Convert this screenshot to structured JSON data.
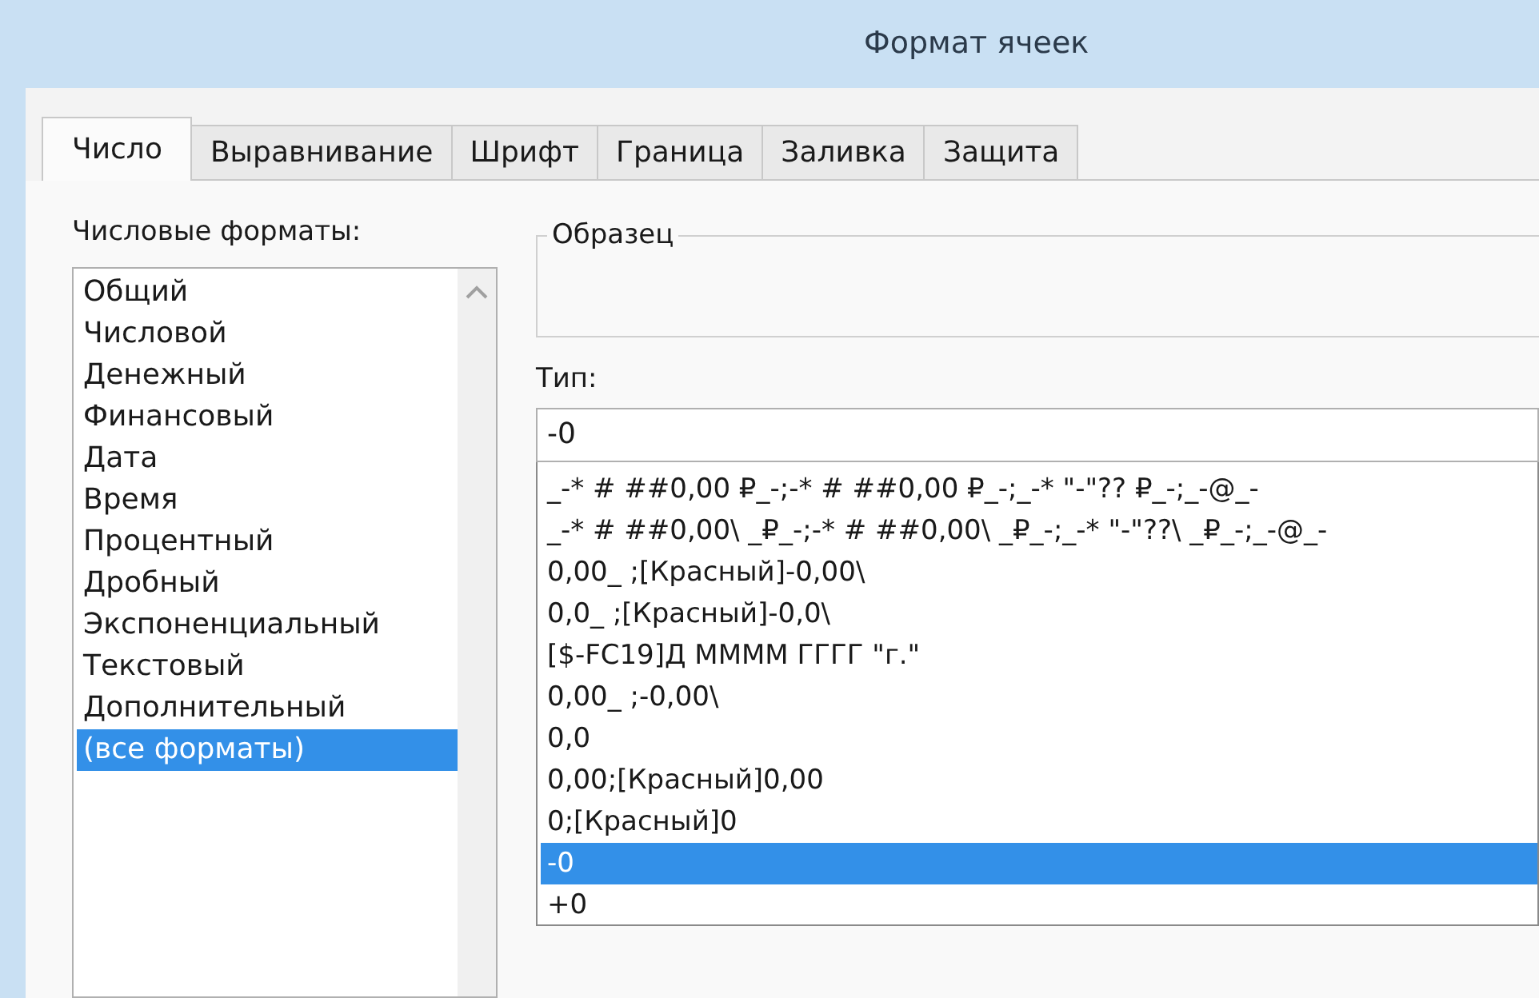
{
  "window": {
    "title": "Формат ячеек"
  },
  "tabs": [
    {
      "label": "Число",
      "selected": true
    },
    {
      "label": "Выравнивание",
      "selected": false
    },
    {
      "label": "Шрифт",
      "selected": false
    },
    {
      "label": "Граница",
      "selected": false
    },
    {
      "label": "Заливка",
      "selected": false
    },
    {
      "label": "Защита",
      "selected": false
    }
  ],
  "categories": {
    "label": "Числовые форматы:",
    "items": [
      {
        "label": "Общий",
        "selected": false
      },
      {
        "label": "Числовой",
        "selected": false
      },
      {
        "label": "Денежный",
        "selected": false
      },
      {
        "label": "Финансовый",
        "selected": false
      },
      {
        "label": "Дата",
        "selected": false
      },
      {
        "label": "Время",
        "selected": false
      },
      {
        "label": "Процентный",
        "selected": false
      },
      {
        "label": "Дробный",
        "selected": false
      },
      {
        "label": "Экспоненциальный",
        "selected": false
      },
      {
        "label": "Текстовый",
        "selected": false
      },
      {
        "label": "Дополнительный",
        "selected": false
      },
      {
        "label": "(все форматы)",
        "selected": true
      }
    ]
  },
  "sample": {
    "label": "Образец"
  },
  "type": {
    "label": "Тип:",
    "value": "-0",
    "items": [
      {
        "label": "_-* # ##0,00 ₽_-;-* # ##0,00 ₽_-;_-* \"-\"?? ₽_-;_-@_-",
        "selected": false
      },
      {
        "label": "_-* # ##0,00\\ _₽_-;-* # ##0,00\\ _₽_-;_-* \"-\"??\\ _₽_-;_-@_-",
        "selected": false
      },
      {
        "label": "0,00_ ;[Красный]-0,00\\",
        "selected": false
      },
      {
        "label": "0,0_ ;[Красный]-0,0\\",
        "selected": false
      },
      {
        "label": "[$-FC19]Д ММММ ГГГГ \"г.\"",
        "selected": false
      },
      {
        "label": "0,00_ ;-0,00\\",
        "selected": false
      },
      {
        "label": "0,0",
        "selected": false
      },
      {
        "label": "0,00;[Красный]0,00",
        "selected": false
      },
      {
        "label": "0;[Красный]0",
        "selected": false
      },
      {
        "label": "-0",
        "selected": true
      },
      {
        "label": "+0",
        "selected": false
      }
    ]
  }
}
